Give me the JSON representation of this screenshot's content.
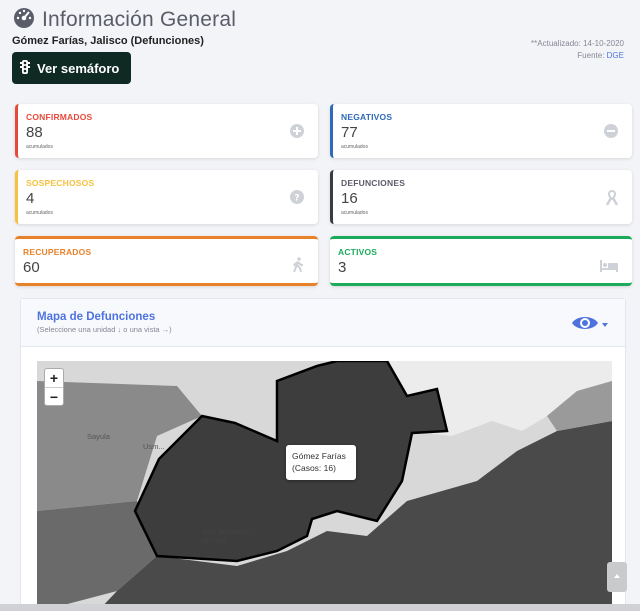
{
  "header": {
    "title": "Información General",
    "subtitle": "Gómez Farías, Jalisco (Defunciones)",
    "semaforo_button": "Ver semáforo",
    "updated": "**Actualizado: 14-10-2020",
    "source_label": "Fuente:",
    "source_value": "DGE"
  },
  "cards": {
    "confirmados": {
      "label": "CONFIRMADOS",
      "value": "88",
      "sub": "acumulados",
      "color": "#e74a3b"
    },
    "negativos": {
      "label": "NEGATIVOS",
      "value": "77",
      "sub": "acumulados",
      "color": "#2e6ab8"
    },
    "sospechosos": {
      "label": "SOSPECHOSOS",
      "value": "4",
      "sub": "acumulados",
      "color": "#f6c23e"
    },
    "defunciones": {
      "label": "DEFUNCIONES",
      "value": "16",
      "sub": "acumulados",
      "color": "#3a3b45"
    },
    "recuperados": {
      "label": "RECUPERADOS",
      "value": "60",
      "color": "#e8822a"
    },
    "activos": {
      "label": "ACTIVOS",
      "value": "3",
      "color": "#1cab5a"
    }
  },
  "icons": [
    "speedometer-icon",
    "traffic-light-icon",
    "plus-circle-icon",
    "minus-circle-icon",
    "question-circle-icon",
    "ribbon-icon",
    "walking-icon",
    "bed-icon",
    "eye-icon",
    "caret-down-icon"
  ],
  "map_panel": {
    "title": "Mapa de Defunciones",
    "hint": "(Seleccione una unidad ↓ o una vista →)",
    "zoom_in": "+",
    "zoom_out": "−",
    "tooltip_line1": "Gómez Farías",
    "tooltip_line2": "(Casos: 16)",
    "labels": {
      "sayula": "Sayula",
      "usmajac": "Usm...",
      "san_sebastian": "San Sebastián del Sur"
    }
  }
}
